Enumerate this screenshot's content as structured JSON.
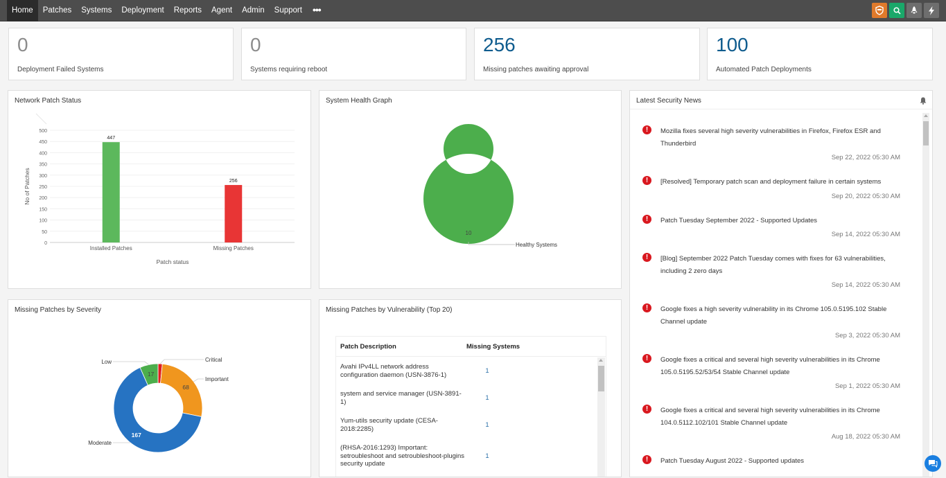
{
  "nav": {
    "items": [
      {
        "label": "Home",
        "active": true
      },
      {
        "label": "Patches"
      },
      {
        "label": "Systems"
      },
      {
        "label": "Deployment"
      },
      {
        "label": "Reports"
      },
      {
        "label": "Agent"
      },
      {
        "label": "Admin"
      },
      {
        "label": "Support"
      }
    ],
    "more_label": "•••",
    "icons": [
      "shield-icon",
      "search-icon",
      "rocket-icon",
      "lightning-icon"
    ]
  },
  "stats": [
    {
      "value": "0",
      "label": "Deployment Failed Systems"
    },
    {
      "value": "0",
      "label": "Systems requiring reboot"
    },
    {
      "value": "256",
      "label": "Missing patches awaiting approval"
    },
    {
      "value": "100",
      "label": "Automated Patch Deployments"
    }
  ],
  "panels": {
    "network_patch_status": "Network Patch Status",
    "system_health": "System Health Graph",
    "latest_news": "Latest Security News",
    "severity": "Missing Patches by Severity",
    "vulnerability": "Missing Patches by Vulnerability (Top 20)"
  },
  "chart_data": [
    {
      "type": "bar",
      "title": "Network Patch Status",
      "categories": [
        "Installed Patches",
        "Missing Patches"
      ],
      "values": [
        447,
        256
      ],
      "colors": [
        "#5cb85c",
        "#e83535"
      ],
      "xlabel": "Patch status",
      "ylabel": "No of Patches",
      "ylim": [
        0,
        500
      ],
      "yticks": [
        0,
        50,
        100,
        150,
        200,
        250,
        300,
        350,
        400,
        450,
        500
      ],
      "grid": true
    },
    {
      "type": "pie",
      "title": "System Health Graph",
      "donut": true,
      "labels": [
        "Healthy Systems"
      ],
      "values": [
        10
      ],
      "colors": [
        "#4cae4c"
      ]
    },
    {
      "type": "pie",
      "title": "Missing Patches by Severity",
      "donut": true,
      "labels": [
        "Critical",
        "Important",
        "Moderate",
        "Low"
      ],
      "values": [
        4,
        68,
        167,
        17
      ],
      "colors": [
        "#e02020",
        "#f0961e",
        "#2673c2",
        "#4cae4c"
      ]
    }
  ],
  "vulnerability_table": {
    "headers": [
      "Patch Description",
      "Missing Systems"
    ],
    "rows": [
      {
        "description": "Avahi IPv4LL network address configuration daemon (USN-3876-1)",
        "count": "1"
      },
      {
        "description": "system and service manager (USN-3891-1)",
        "count": "1"
      },
      {
        "description": "Yum-utils security update (CESA-2018:2285)",
        "count": "1"
      },
      {
        "description": "(RHSA-2016:1293) Important: setroubleshoot and setroubleshoot-plugins security update",
        "count": "1"
      }
    ]
  },
  "news": [
    {
      "text": "Mozilla fixes several high severity vulnerabilities in Firefox, Firefox ESR and Thunderbird",
      "date": "Sep 22, 2022 05:30 AM"
    },
    {
      "text": "[Resolved] Temporary patch scan and deployment failure in certain systems",
      "date": "Sep 20, 2022 05:30 AM"
    },
    {
      "text": "Patch Tuesday September 2022 - Supported Updates",
      "date": "Sep 14, 2022 05:30 AM"
    },
    {
      "text": "[Blog] September 2022 Patch Tuesday comes with fixes for 63 vulnerabilities, including 2 zero days",
      "date": "Sep 14, 2022 05:30 AM"
    },
    {
      "text": "Google fixes a high severity vulnerability in its Chrome 105.0.5195.102 Stable Channel update",
      "date": "Sep 3, 2022 05:30 AM"
    },
    {
      "text": "Google fixes a critical and several high severity vulnerabilities in its Chrome 105.0.5195.52/53/54 Stable Channel update",
      "date": "Sep 1, 2022 05:30 AM"
    },
    {
      "text": "Google fixes a critical and several high severity vulnerabilities in its Chrome 104.0.5112.102/101 Stable Channel update",
      "date": "Aug 18, 2022 05:30 AM"
    },
    {
      "text": "Patch Tuesday August 2022 - Supported updates",
      "date": ""
    }
  ]
}
